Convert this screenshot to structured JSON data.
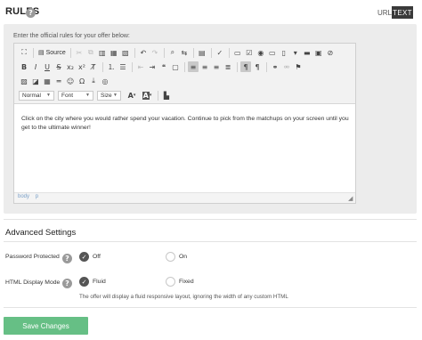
{
  "header": {
    "title": "RULES",
    "help_glyph": "?",
    "mode_url": "URL",
    "mode_text": "TEXT"
  },
  "editor": {
    "instructions": "Enter the official rules for your offer below:",
    "source_label": "Source",
    "dropdowns": {
      "format": "Normal",
      "font": "Font",
      "size": "Size"
    },
    "content": "Click on the city where you would rather spend your vacation.  Continue to pick from the matchups on your screen until you get to the ultimate winner!",
    "path": [
      "body",
      "p"
    ]
  },
  "advanced": {
    "title": "Advanced Settings",
    "password": {
      "label": "Password Protected",
      "option_off": "Off",
      "option_on": "On",
      "selected": "Off"
    },
    "display": {
      "label": "HTML Display Mode",
      "option_fluid": "Fluid",
      "option_fixed": "Fixed",
      "selected": "Fluid",
      "note": "The offer will display a fluid responsive layout, ignoring the width of any custom HTML"
    }
  },
  "actions": {
    "save_label": "Save Changes"
  },
  "colors": {
    "save": "#66bf85",
    "text_mode": "#3a3a3a",
    "panel": "#ececec"
  }
}
